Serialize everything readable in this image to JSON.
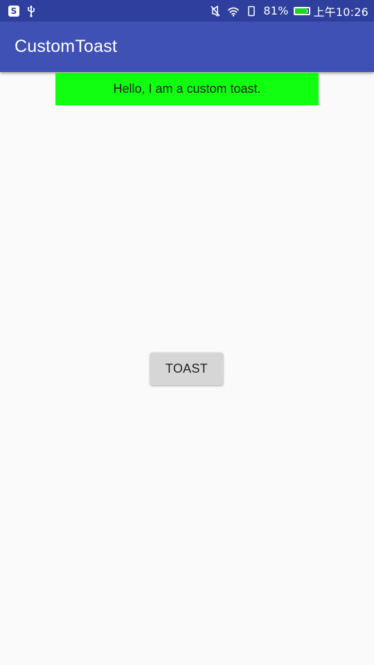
{
  "status_bar": {
    "left_icons": [
      "s-app-icon",
      "usb-icon"
    ],
    "battery_percent": "81%",
    "battery_level": 0.81,
    "time": "上午10:26",
    "battery_fill_color": "#22d427"
  },
  "app_bar": {
    "title": "CustomToast",
    "background_color": "#3f51b5"
  },
  "toast": {
    "message": "Hello, I am a custom toast.",
    "background_color": "#11ff11"
  },
  "main": {
    "button_label": "TOAST"
  }
}
